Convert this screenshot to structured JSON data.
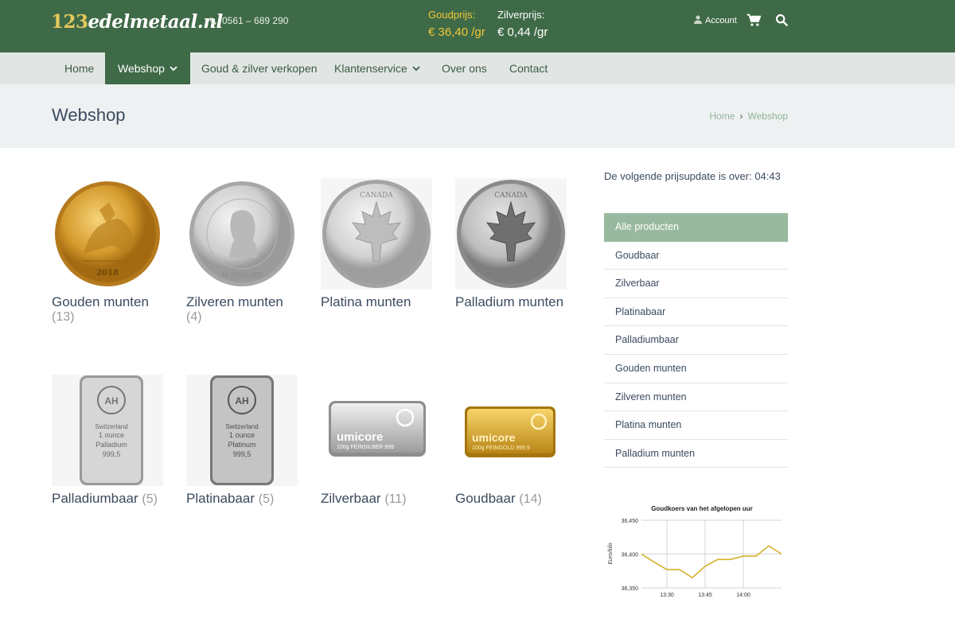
{
  "header": {
    "logo_num": "123",
    "logo_text": "edelmetaal.nl",
    "phone": "0561 – 689 290",
    "gold_label": "Goudprijs:",
    "gold_value": "€ 36,40 /gr",
    "silver_label": "Zilverprijs:",
    "silver_value": "€ 0,44 /gr",
    "account_label": "Account",
    "colors": {
      "bar": "#3f6a47",
      "gold": "#f0c83a"
    }
  },
  "nav": {
    "items": [
      {
        "label": "Home"
      },
      {
        "label": "Webshop",
        "active": true,
        "dropdown": true
      },
      {
        "label": "Goud & zilver verkopen"
      },
      {
        "label": "Klantenservice",
        "dropdown": true
      },
      {
        "label": "Over ons"
      },
      {
        "label": "Contact"
      }
    ]
  },
  "page": {
    "title": "Webshop",
    "breadcrumb": {
      "home": "Home",
      "current": "Webshop"
    }
  },
  "products": [
    {
      "name": "Gouden munten",
      "count": "(13)",
      "icon": "gold-coin-icon"
    },
    {
      "name": "Zilveren munten",
      "count": "(4)",
      "icon": "silver-coin-icon"
    },
    {
      "name": "Platina munten",
      "count": "",
      "icon": "platinum-coin-icon"
    },
    {
      "name": "Palladium munten",
      "count": "",
      "icon": "palladium-coin-icon"
    },
    {
      "name": "Palladiumbaar",
      "count": "(5)",
      "icon": "palladium-bar-icon",
      "bar_text": [
        "Switzerland",
        "1 ounce",
        "Palladium",
        "999,5"
      ]
    },
    {
      "name": "Platinabaar",
      "count": "(5)",
      "icon": "platinum-bar-icon",
      "bar_text": [
        "Switzerland",
        "1 ounce",
        "Platinum",
        "999,5"
      ]
    },
    {
      "name": "Zilverbaar",
      "count": "(11)",
      "icon": "silver-bar-icon",
      "bar_brand": "umicore",
      "bar_text": [
        "100g FEINSILBER 999"
      ]
    },
    {
      "name": "Goudbaar",
      "count": "(14)",
      "icon": "gold-bar-icon",
      "bar_brand": "umicore",
      "bar_text": [
        "100g FEINGOLD 999,9"
      ]
    }
  ],
  "coin_text": {
    "sovereign_year": "2018",
    "maple": "CANADA",
    "australia": "ELIZABETH II AUSTRALIA",
    "dollars": "30 DOLLARS"
  },
  "sidebar": {
    "update_text": "De volgende prijsupdate is over: 04:43",
    "categories": [
      {
        "label": "Alle producten",
        "active": true
      },
      {
        "label": "Goudbaar"
      },
      {
        "label": "Zilverbaar"
      },
      {
        "label": "Platinabaar"
      },
      {
        "label": "Palladiumbaar"
      },
      {
        "label": "Gouden munten"
      },
      {
        "label": "Zilveren munten"
      },
      {
        "label": "Platina munten"
      },
      {
        "label": "Palladium munten"
      }
    ]
  },
  "chart_data": {
    "type": "line",
    "title": "Goudkoers van het afgelopen uur",
    "ylabel": "Euro/kilo",
    "xlabel": "",
    "ylim": [
      36350,
      36450
    ],
    "yticks": [
      "36,350",
      "36,400",
      "36,450"
    ],
    "xticks": [
      "13:30",
      "13:45",
      "14:00"
    ],
    "series": [
      {
        "color": "#d4b12a",
        "x": [
          "13:20",
          "13:25",
          "13:30",
          "13:35",
          "13:40",
          "13:45",
          "13:50",
          "13:55",
          "14:00",
          "14:05",
          "14:10",
          "14:15"
        ],
        "values": [
          36400,
          36388,
          36377,
          36377,
          36365,
          36382,
          36392,
          36392,
          36397,
          36397,
          36412,
          36400
        ]
      }
    ]
  }
}
